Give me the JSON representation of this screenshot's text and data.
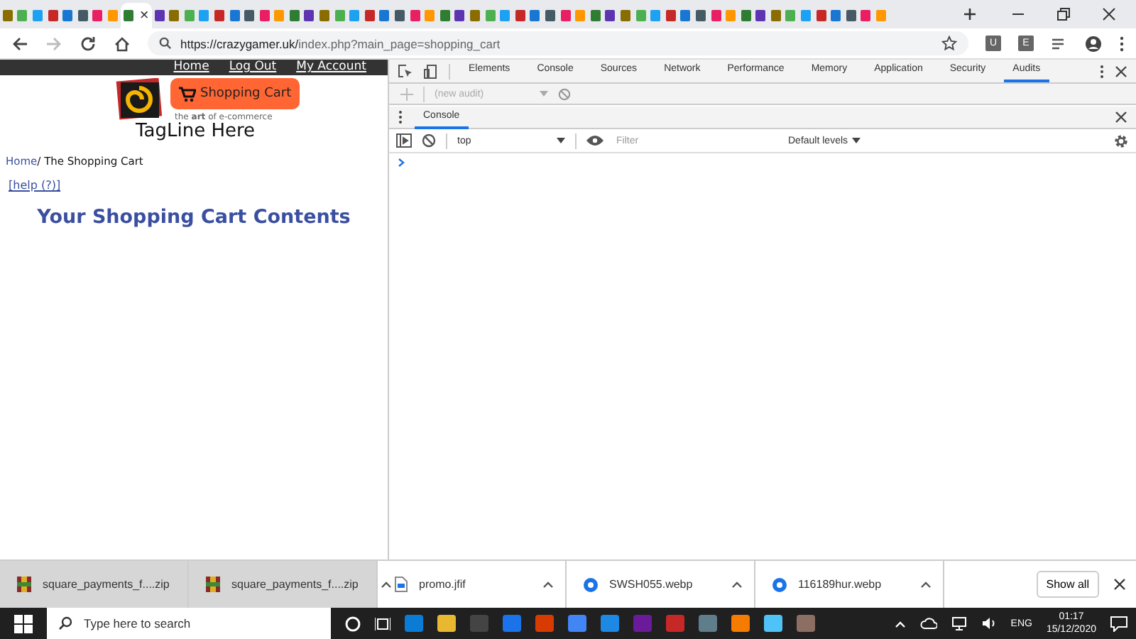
{
  "browser": {
    "tabs": [
      {
        "selected": false
      },
      {
        "selected": false
      },
      {
        "selected": false
      },
      {
        "selected": false
      },
      {
        "selected": false
      },
      {
        "selected": false
      },
      {
        "selected": false
      },
      {
        "selected": false
      },
      {
        "selected": true,
        "close": "×"
      },
      {
        "selected": false
      },
      {
        "selected": false
      },
      {
        "selected": false
      },
      {
        "selected": false
      },
      {
        "selected": false
      },
      {
        "selected": false
      },
      {
        "selected": false
      },
      {
        "selected": false
      },
      {
        "selected": false
      },
      {
        "selected": false
      },
      {
        "selected": false
      },
      {
        "selected": false
      },
      {
        "selected": false
      },
      {
        "selected": false
      },
      {
        "selected": false
      },
      {
        "selected": false
      },
      {
        "selected": false
      },
      {
        "selected": false
      },
      {
        "selected": false
      },
      {
        "selected": false
      },
      {
        "selected": false
      },
      {
        "selected": false
      },
      {
        "selected": false
      },
      {
        "selected": false
      },
      {
        "selected": false
      },
      {
        "selected": false
      },
      {
        "selected": false
      },
      {
        "selected": false
      },
      {
        "selected": false
      },
      {
        "selected": false
      },
      {
        "selected": false
      },
      {
        "selected": false
      },
      {
        "selected": false
      },
      {
        "selected": false
      },
      {
        "selected": false
      },
      {
        "selected": false
      },
      {
        "selected": false
      },
      {
        "selected": false
      },
      {
        "selected": false
      },
      {
        "selected": false
      },
      {
        "selected": false
      },
      {
        "selected": false
      },
      {
        "selected": false
      },
      {
        "selected": false
      },
      {
        "selected": false
      },
      {
        "selected": false
      },
      {
        "selected": false
      },
      {
        "selected": false
      },
      {
        "selected": false
      }
    ],
    "url_host": "https://crazygamer.uk/",
    "url_path": "index.php?main_page=shopping_cart",
    "extensions": [
      "U",
      "E"
    ]
  },
  "page": {
    "nav": [
      "Home",
      "Log Out",
      "My Account"
    ],
    "cart_button": "Shopping Cart",
    "logo_tagline": "the **art** of e-commerce",
    "tagline": "TagLine Here",
    "breadcrumb_link": "Home",
    "breadcrumb_current": "/ The Shopping Cart",
    "help_link": "[help (?)]",
    "heading": "Your Shopping Cart Contents"
  },
  "devtools": {
    "tabs": [
      {
        "label": "Elements",
        "selected": false
      },
      {
        "label": "Console",
        "selected": false
      },
      {
        "label": "Sources",
        "selected": false
      },
      {
        "label": "Network",
        "selected": false
      },
      {
        "label": "Performance",
        "selected": false
      },
      {
        "label": "Memory",
        "selected": false
      },
      {
        "label": "Application",
        "selected": false
      },
      {
        "label": "Security",
        "selected": false
      },
      {
        "label": "Audits",
        "selected": true
      }
    ],
    "audit_select": "(new audit)",
    "drawer_tab": "Console",
    "context": "top",
    "filter_placeholder": "Filter",
    "levels": "Default levels"
  },
  "downloads": {
    "items": [
      {
        "name": "square_payments_f....zip",
        "selected": true
      },
      {
        "name": "square_payments_f....zip",
        "selected": true
      },
      {
        "name": "promo.jfif",
        "selected": false
      },
      {
        "name": "SWSH055.webp",
        "selected": false
      },
      {
        "name": "116189hur.webp",
        "selected": false
      }
    ],
    "show_all": "Show all"
  },
  "taskbar": {
    "search_placeholder": "Type here to search",
    "language": "ENG",
    "time": "01:17",
    "date": "15/12/2020"
  }
}
